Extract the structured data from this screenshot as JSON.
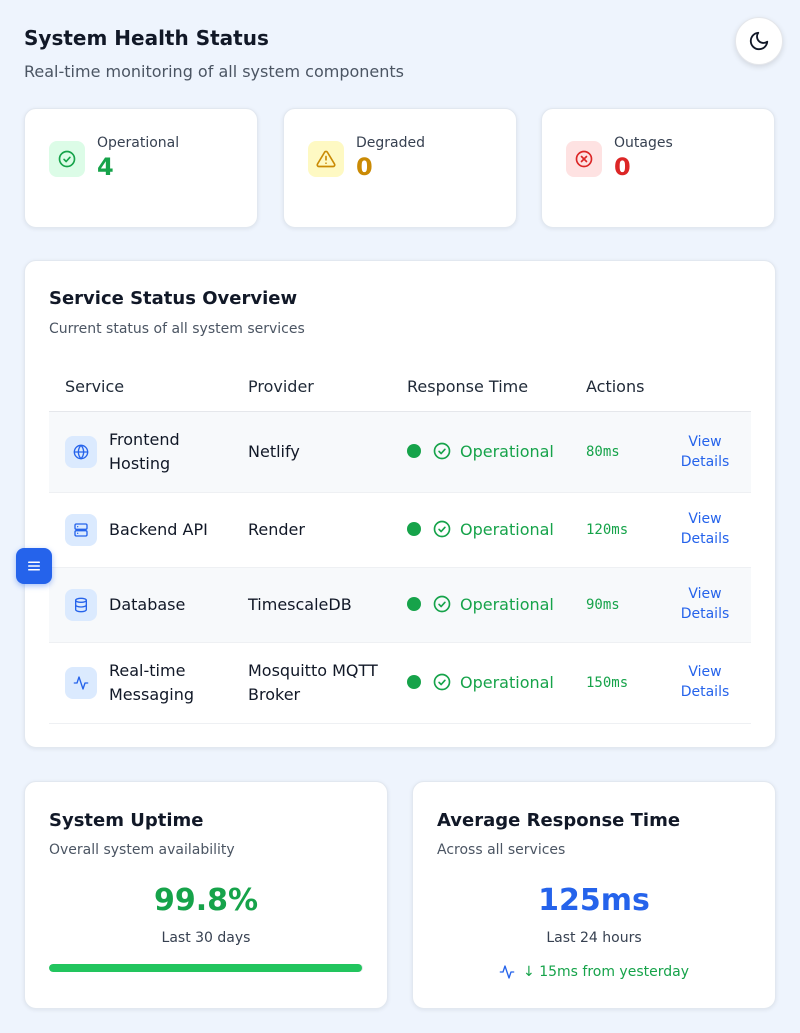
{
  "header": {
    "title": "System Health Status",
    "subtitle": "Real-time monitoring of all system components",
    "theme_toggle_icon": "moon-icon"
  },
  "stats": [
    {
      "label": "Operational",
      "value": "4",
      "icon": "check-circle-icon",
      "color": "#16a34a",
      "bg": "#dcfce7"
    },
    {
      "label": "Degraded",
      "value": "0",
      "icon": "warning-triangle-icon",
      "color": "#ca8a04",
      "bg": "#fef9c3"
    },
    {
      "label": "Outages",
      "value": "0",
      "icon": "x-circle-icon",
      "color": "#dc2626",
      "bg": "#fee2e2"
    }
  ],
  "overview": {
    "title": "Service Status Overview",
    "subtitle": "Current status of all system services",
    "columns": [
      "Service",
      "Provider",
      "Response Time",
      "Actions"
    ],
    "rows": [
      {
        "service": "Frontend Hosting",
        "provider": "Netlify",
        "status": "Operational",
        "response": "80ms",
        "action": "View Details",
        "icon": "globe-icon"
      },
      {
        "service": "Backend API",
        "provider": "Render",
        "status": "Operational",
        "response": "120ms",
        "action": "View Details",
        "icon": "server-icon"
      },
      {
        "service": "Database",
        "provider": "TimescaleDB",
        "status": "Operational",
        "response": "90ms",
        "action": "View Details",
        "icon": "database-icon"
      },
      {
        "service": "Real-time Messaging",
        "provider": "Mosquitto MQTT Broker",
        "status": "Operational",
        "response": "150ms",
        "action": "View Details",
        "icon": "activity-icon"
      }
    ]
  },
  "uptime": {
    "title": "System Uptime",
    "subtitle": "Overall system availability",
    "value": "99.8%",
    "period": "Last 30 days",
    "progress_percent": 99.8,
    "color": "#16a34a"
  },
  "avg_response": {
    "title": "Average Response Time",
    "subtitle": "Across all services",
    "value": "125ms",
    "period": "Last 24 hours",
    "trend": "↓ 15ms from yesterday",
    "color": "#2563eb"
  },
  "colors": {
    "accent": "#2563eb",
    "success": "#16a34a",
    "background": "#eef4fd"
  }
}
